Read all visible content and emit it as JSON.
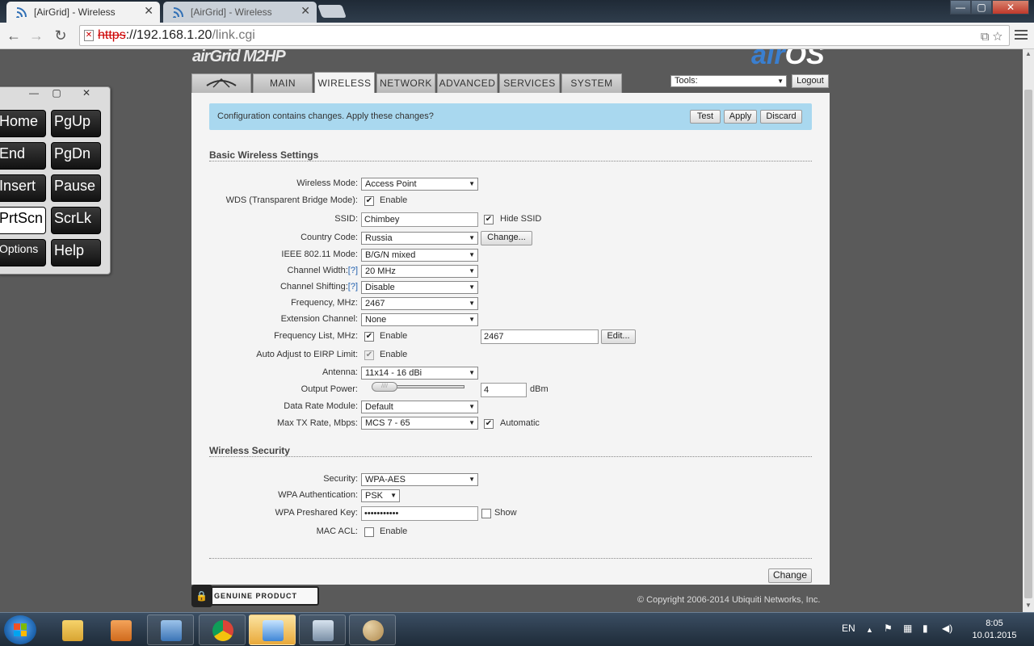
{
  "browser": {
    "tabs": [
      {
        "title": "[AirGrid] - Wireless",
        "active": true
      },
      {
        "title": "[AirGrid] - Wireless",
        "active": false
      }
    ],
    "tab_close": "✕",
    "url": {
      "scheme": "https",
      "host": "://192.168.1.20",
      "path": "/link.cgi"
    },
    "window_buttons": {
      "minimize": "—",
      "maximize": "▢",
      "close": "✕"
    }
  },
  "header": {
    "logo_left": "airGrid M2HP",
    "logo_right_prefix": "air",
    "logo_right_suffix": "OS"
  },
  "main_tabs": [
    "MAIN",
    "WIRELESS",
    "NETWORK",
    "ADVANCED",
    "SERVICES",
    "SYSTEM"
  ],
  "tools": {
    "label": "Tools:"
  },
  "logout_label": "Logout",
  "notice": {
    "message": "Configuration contains changes. Apply these changes?",
    "test": "Test",
    "apply": "Apply",
    "discard": "Discard"
  },
  "basic": {
    "title": "Basic Wireless Settings",
    "wireless_mode": {
      "label": "Wireless Mode:",
      "value": "Access Point"
    },
    "wds": {
      "label": "WDS (Transparent Bridge Mode):",
      "checkbox": "Enable",
      "checked": true
    },
    "ssid": {
      "label": "SSID:",
      "value": "Chimbey",
      "hide_label": "Hide SSID",
      "hide_checked": true
    },
    "country": {
      "label": "Country Code:",
      "value": "Russia",
      "change": "Change..."
    },
    "ieee": {
      "label": "IEEE 802.11 Mode:",
      "value": "B/G/N mixed"
    },
    "channel_width": {
      "label": "Channel Width:",
      "help": "[?]",
      "value": "20 MHz"
    },
    "channel_shifting": {
      "label": "Channel Shifting:",
      "help": "[?]",
      "value": "Disable"
    },
    "frequency": {
      "label": "Frequency, MHz:",
      "value": "2467"
    },
    "extension": {
      "label": "Extension Channel:",
      "value": "None"
    },
    "freq_list": {
      "label": "Frequency List, MHz:",
      "checkbox": "Enable",
      "checked": true,
      "value": "2467",
      "edit": "Edit..."
    },
    "eirp": {
      "label": "Auto Adjust to EIRP Limit:",
      "checkbox": "Enable",
      "checked": true
    },
    "antenna": {
      "label": "Antenna:",
      "value": "11x14 - 16 dBi"
    },
    "output_power": {
      "label": "Output Power:",
      "value": "4",
      "unit": "dBm",
      "level": 0.1
    },
    "data_rate": {
      "label": "Data Rate Module:",
      "value": "Default"
    },
    "max_tx": {
      "label": "Max TX Rate, Mbps:",
      "value": "MCS 7 - 65",
      "checkbox": "Automatic",
      "checked": true
    }
  },
  "security": {
    "title": "Wireless Security",
    "security": {
      "label": "Security:",
      "value": "WPA-AES"
    },
    "wpa_auth": {
      "label": "WPA Authentication:",
      "value": "PSK"
    },
    "psk": {
      "label": "WPA Preshared Key:",
      "value": "•••••••••••",
      "show": "Show",
      "show_checked": false
    },
    "mac_acl": {
      "label": "MAC ACL:",
      "checkbox": "Enable",
      "checked": false
    }
  },
  "change_label": "Change",
  "footer": {
    "genuine": "GENUINE PRODUCT",
    "copyright": "© Copyright 2006-2014 Ubiquiti Networks, Inc."
  },
  "osk": {
    "keys": [
      "Home",
      "PgUp",
      "End",
      "PgDn",
      "Insert",
      "Pause",
      "PrtScn",
      "ScrLk",
      "Options",
      "Help"
    ],
    "window_buttons": {
      "minimize": "—",
      "restore": "▢",
      "close": "✕"
    }
  },
  "taskbar": {
    "language": "EN",
    "time": "8:05",
    "date": "10.01.2015"
  },
  "colors": {
    "notice_bg": "#a9d8ef",
    "link_blue": "#2563b0",
    "taskbar": "#2c3b4c"
  }
}
